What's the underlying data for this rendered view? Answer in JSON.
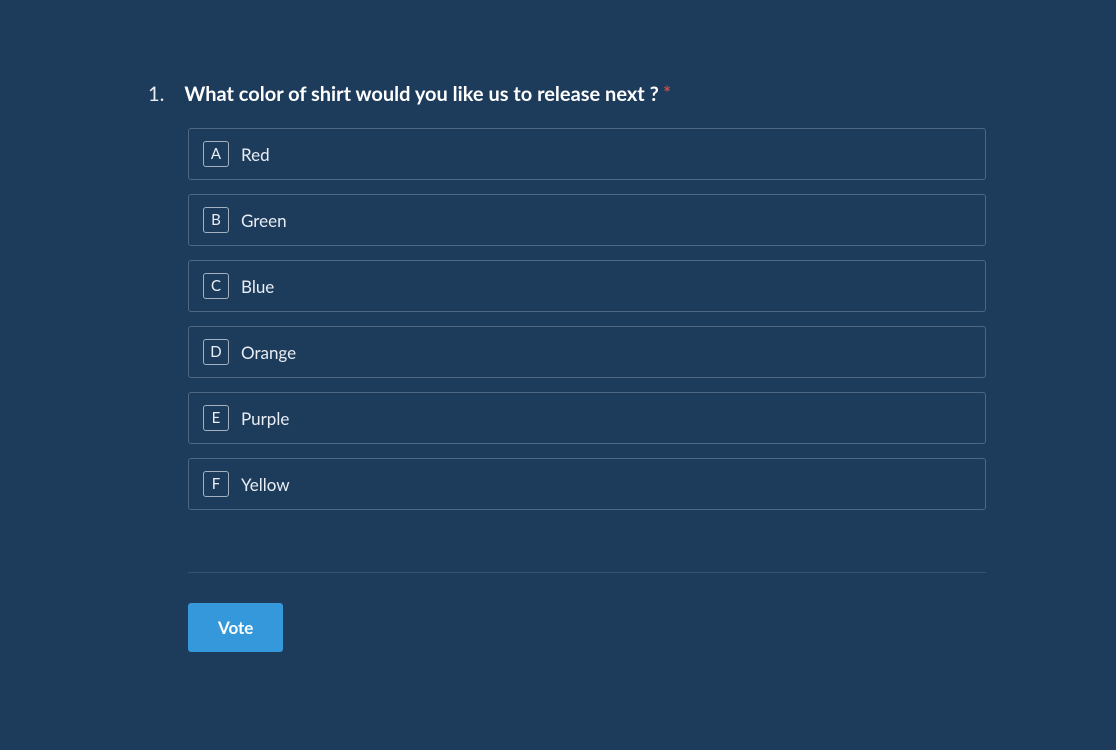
{
  "question": {
    "number": "1.",
    "text": "What color of shirt would you like us to release next ?",
    "required_marker": "*",
    "options": [
      {
        "key": "A",
        "label": "Red"
      },
      {
        "key": "B",
        "label": "Green"
      },
      {
        "key": "C",
        "label": "Blue"
      },
      {
        "key": "D",
        "label": "Orange"
      },
      {
        "key": "E",
        "label": "Purple"
      },
      {
        "key": "F",
        "label": "Yellow"
      }
    ]
  },
  "submit_label": "Vote"
}
